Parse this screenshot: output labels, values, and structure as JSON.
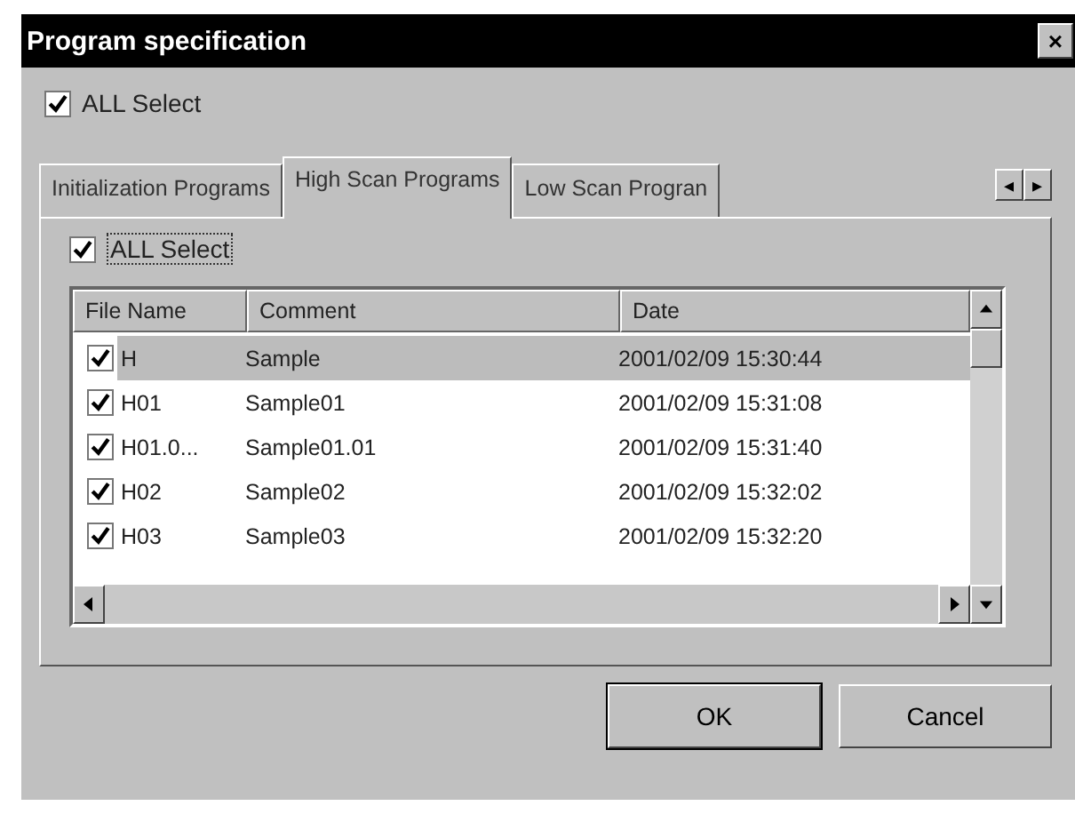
{
  "window": {
    "title": "Program specification",
    "close": "×"
  },
  "all_select": {
    "label": "ALL Select",
    "checked": true
  },
  "tabs": [
    {
      "label": "Initialization Programs",
      "selected": false
    },
    {
      "label": "High Scan Programs",
      "selected": true
    },
    {
      "label": "Low Scan Progran",
      "selected": false
    }
  ],
  "tab_scroll": {
    "left": "◂",
    "right": "▸"
  },
  "tab_all_select": {
    "label": "ALL Select",
    "checked": true
  },
  "table": {
    "columns": [
      "File Name",
      "Comment",
      "Date"
    ],
    "rows": [
      {
        "cells": [
          "H",
          "Sample",
          "2001/02/09 15:30:44"
        ],
        "checked": true,
        "selected": true
      },
      {
        "cells": [
          "H01",
          "Sample01",
          "2001/02/09 15:31:08"
        ],
        "checked": true,
        "selected": false
      },
      {
        "cells": [
          "H01.0...",
          "Sample01.01",
          "2001/02/09 15:31:40"
        ],
        "checked": true,
        "selected": false
      },
      {
        "cells": [
          "H02",
          "Sample02",
          "2001/02/09 15:32:02"
        ],
        "checked": true,
        "selected": false
      },
      {
        "cells": [
          "H03",
          "Sample03",
          "2001/02/09 15:32:20"
        ],
        "checked": true,
        "selected": false
      }
    ]
  },
  "buttons": [
    "OK",
    "Cancel"
  ]
}
